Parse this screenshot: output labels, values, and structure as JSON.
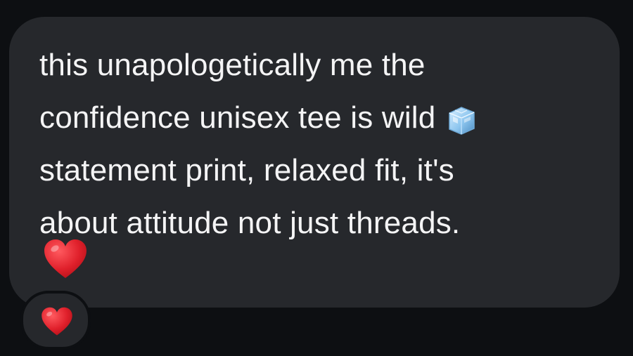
{
  "message": {
    "lines": [
      "this unapologetically me the",
      "confidence unisex tee is wild",
      "statement print, relaxed fit, it's",
      "about attitude not just threads."
    ],
    "inline_emoji": "ice-cube-icon",
    "trailing_emoji": "red-heart-icon"
  },
  "reaction": {
    "emoji": "red-heart-icon"
  },
  "colors": {
    "background": "#0d0f12",
    "bubble": "#26282c",
    "text": "#f4f4f5",
    "heart": "#e0202b",
    "ice": "#8ec6ef"
  }
}
